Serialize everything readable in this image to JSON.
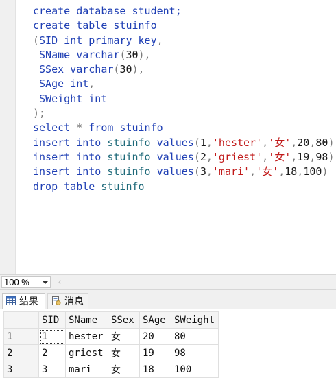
{
  "editor": {
    "lines": [
      [
        {
          "t": "create database student;",
          "c": "kw"
        }
      ],
      [
        {
          "t": "create table stuinfo",
          "c": "kw"
        }
      ],
      [
        {
          "t": "(",
          "c": "gr"
        },
        {
          "t": "SID int primary key",
          "c": "kw"
        },
        {
          "t": ",",
          "c": "gr"
        }
      ],
      [
        {
          "t": " SName varchar",
          "c": "kw"
        },
        {
          "t": "(",
          "c": "gr"
        },
        {
          "t": "30",
          "c": "bl"
        },
        {
          "t": "),",
          "c": "gr"
        }
      ],
      [
        {
          "t": " SSex varchar",
          "c": "kw"
        },
        {
          "t": "(",
          "c": "gr"
        },
        {
          "t": "30",
          "c": "bl"
        },
        {
          "t": "),",
          "c": "gr"
        }
      ],
      [
        {
          "t": " SAge int",
          "c": "kw"
        },
        {
          "t": ",",
          "c": "gr"
        }
      ],
      [
        {
          "t": " SWeight int",
          "c": "kw"
        }
      ],
      [
        {
          "t": ");",
          "c": "gr"
        }
      ],
      [
        {
          "t": "select ",
          "c": "kw"
        },
        {
          "t": "* ",
          "c": "gr"
        },
        {
          "t": "from stuinfo",
          "c": "kw"
        }
      ],
      [
        {
          "t": "insert into ",
          "c": "kw"
        },
        {
          "t": "stuinfo ",
          "c": "id"
        },
        {
          "t": "values",
          "c": "kw"
        },
        {
          "t": "(",
          "c": "gr"
        },
        {
          "t": "1",
          "c": "bl"
        },
        {
          "t": ",",
          "c": "gr"
        },
        {
          "t": "'hester'",
          "c": "str"
        },
        {
          "t": ",",
          "c": "gr"
        },
        {
          "t": "'女'",
          "c": "str"
        },
        {
          "t": ",",
          "c": "gr"
        },
        {
          "t": "20",
          "c": "bl"
        },
        {
          "t": ",",
          "c": "gr"
        },
        {
          "t": "80",
          "c": "bl"
        },
        {
          "t": ")",
          "c": "gr"
        }
      ],
      [
        {
          "t": "insert into ",
          "c": "kw"
        },
        {
          "t": "stuinfo ",
          "c": "id"
        },
        {
          "t": "values",
          "c": "kw"
        },
        {
          "t": "(",
          "c": "gr"
        },
        {
          "t": "2",
          "c": "bl"
        },
        {
          "t": ",",
          "c": "gr"
        },
        {
          "t": "'griest'",
          "c": "str"
        },
        {
          "t": ",",
          "c": "gr"
        },
        {
          "t": "'女'",
          "c": "str"
        },
        {
          "t": ",",
          "c": "gr"
        },
        {
          "t": "19",
          "c": "bl"
        },
        {
          "t": ",",
          "c": "gr"
        },
        {
          "t": "98",
          "c": "bl"
        },
        {
          "t": ")",
          "c": "gr"
        }
      ],
      [
        {
          "t": "insert into ",
          "c": "kw"
        },
        {
          "t": "stuinfo ",
          "c": "id"
        },
        {
          "t": "values",
          "c": "kw"
        },
        {
          "t": "(",
          "c": "gr"
        },
        {
          "t": "3",
          "c": "bl"
        },
        {
          "t": ",",
          "c": "gr"
        },
        {
          "t": "'mari'",
          "c": "str"
        },
        {
          "t": ",",
          "c": "gr"
        },
        {
          "t": "'女'",
          "c": "str"
        },
        {
          "t": ",",
          "c": "gr"
        },
        {
          "t": "18",
          "c": "bl"
        },
        {
          "t": ",",
          "c": "gr"
        },
        {
          "t": "100",
          "c": "bl"
        },
        {
          "t": ")",
          "c": "gr"
        }
      ],
      [
        {
          "t": "drop table ",
          "c": "kw"
        },
        {
          "t": "stuinfo",
          "c": "id"
        }
      ]
    ]
  },
  "zoom": {
    "value": "100 %"
  },
  "tabs": {
    "results": "结果",
    "messages": "消息"
  },
  "grid": {
    "columns": [
      "SID",
      "SName",
      "SSex",
      "SAge",
      "SWeight"
    ],
    "rows": [
      {
        "num": "1",
        "cells": [
          "1",
          "hester",
          "女",
          "20",
          "80"
        ]
      },
      {
        "num": "2",
        "cells": [
          "2",
          "griest",
          "女",
          "19",
          "98"
        ]
      },
      {
        "num": "3",
        "cells": [
          "3",
          "mari",
          "女",
          "18",
          "100"
        ]
      }
    ]
  },
  "icons": {
    "results_tab": "grid-icon",
    "messages_tab": "message-doc-icon",
    "zoom_dropdown": "chevron-down-icon",
    "scroll_left": "chevron-left-icon"
  }
}
